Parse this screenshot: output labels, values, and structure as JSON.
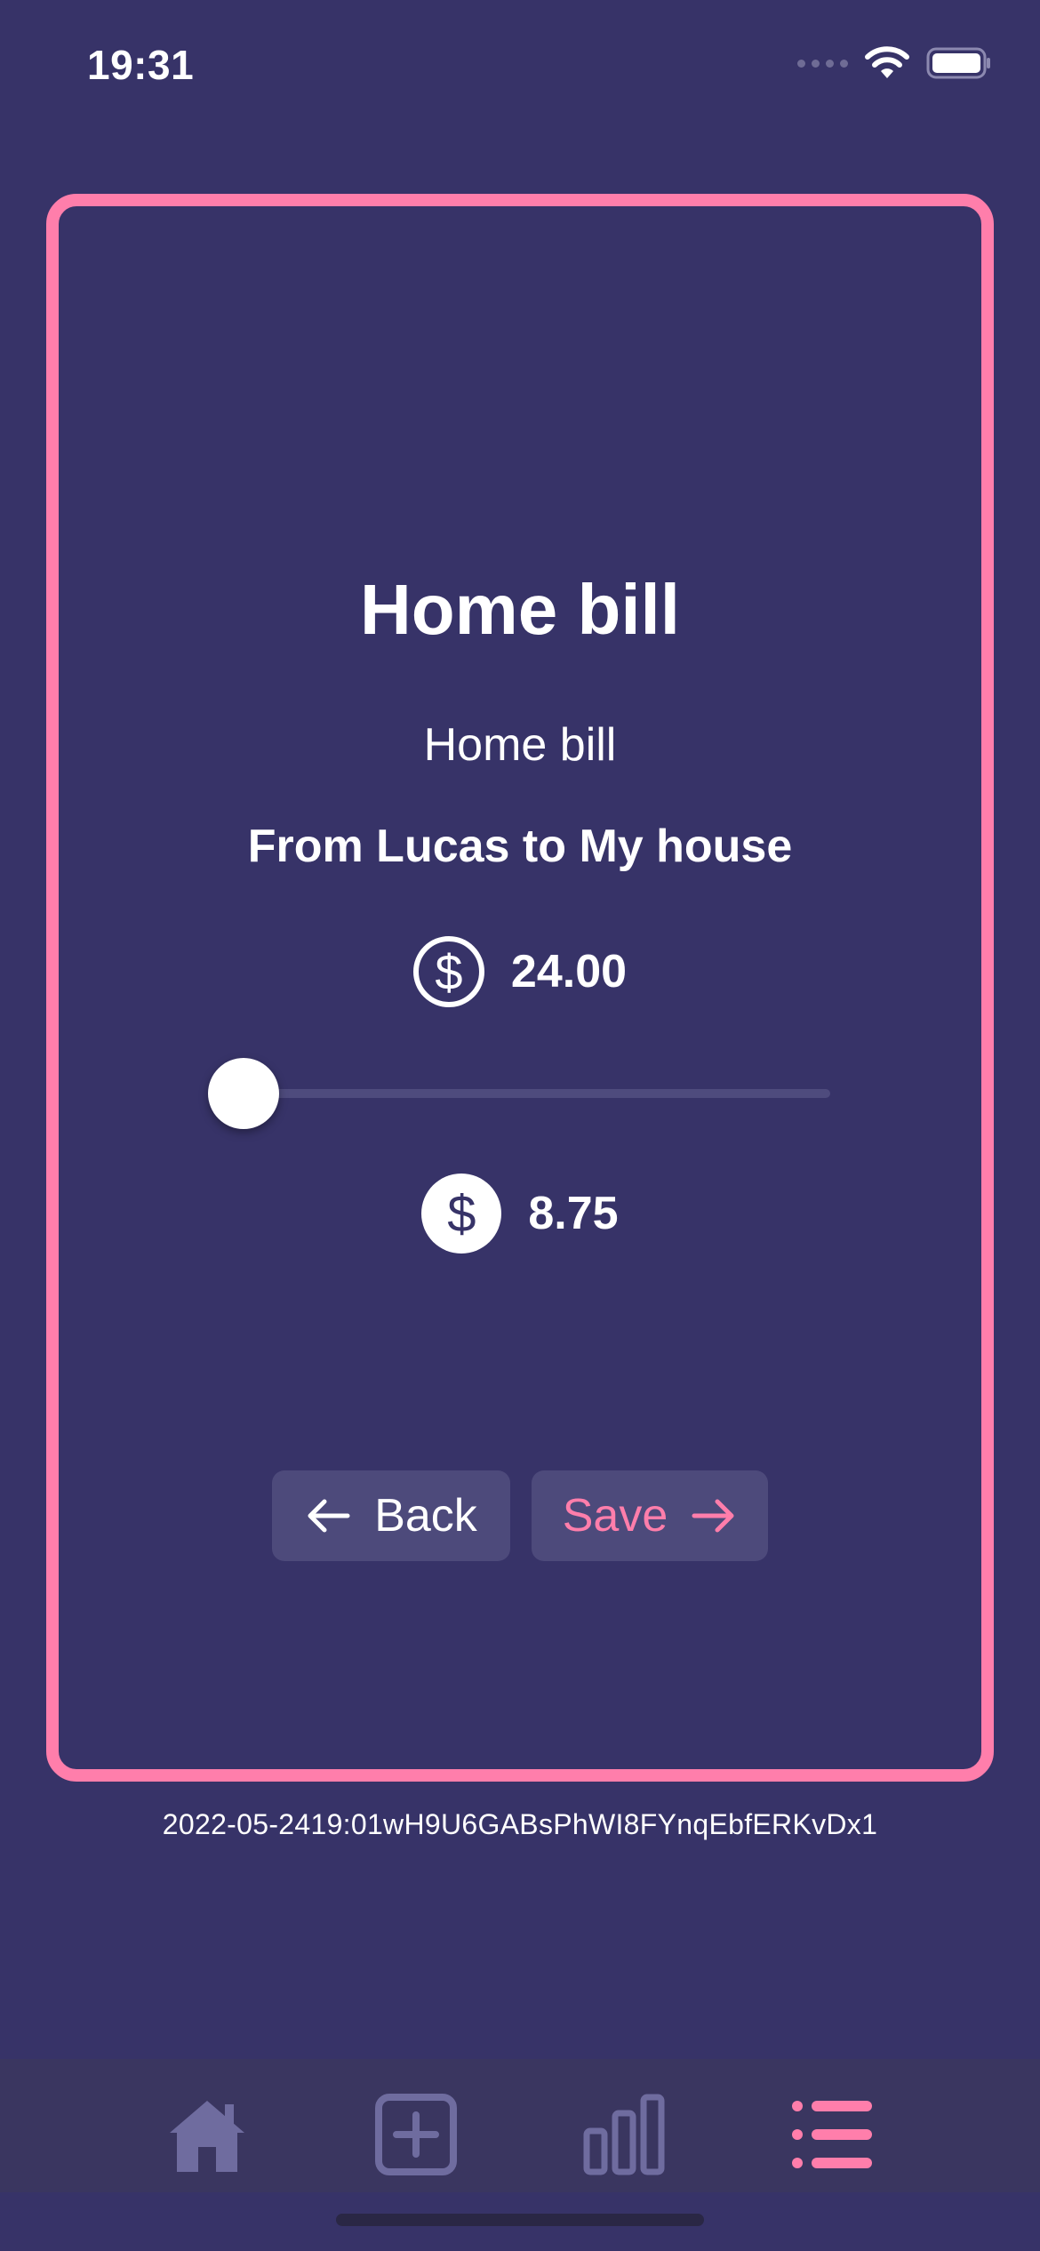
{
  "status_bar": {
    "time": "19:31"
  },
  "card": {
    "title": "Home bill",
    "description": "Home bill",
    "from_to": "From Lucas to My house",
    "total_amount": "24.00",
    "share_amount": "8.75",
    "slider_value_fraction": 0.0
  },
  "buttons": {
    "back_label": "Back",
    "save_label": "Save"
  },
  "timestamp": "2022-05-2419:01wH9U6GABsPhWI8FYnqEbfERKvDx1",
  "tabbar": {
    "items": [
      {
        "icon": "home-icon",
        "active": false
      },
      {
        "icon": "add-square-icon",
        "active": false
      },
      {
        "icon": "bar-chart-icon",
        "active": false
      },
      {
        "icon": "list-icon",
        "active": true
      }
    ]
  },
  "colors": {
    "background": "#373368",
    "accent": "#ff7eab",
    "button_bg": "#4d4a7b",
    "tab_inactive": "#6f6c9f",
    "tabbar_bg": "#3a3660"
  }
}
